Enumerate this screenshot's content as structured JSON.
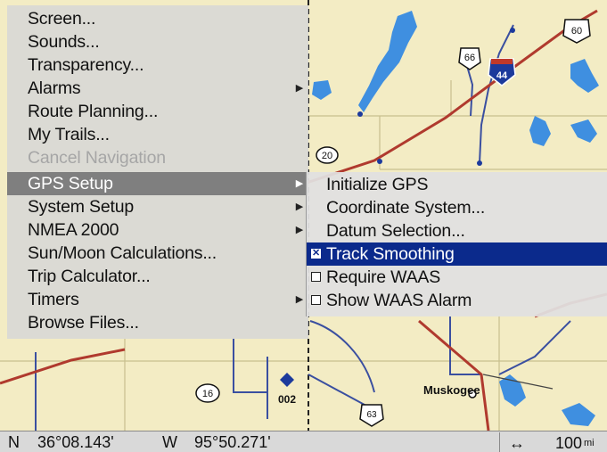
{
  "main_menu": {
    "items": [
      {
        "label": "Screen...",
        "submenu": false,
        "disabled": false,
        "active": false
      },
      {
        "label": "Sounds...",
        "submenu": false,
        "disabled": false,
        "active": false
      },
      {
        "label": "Transparency...",
        "submenu": false,
        "disabled": false,
        "active": false
      },
      {
        "label": "Alarms",
        "submenu": true,
        "disabled": false,
        "active": false
      },
      {
        "label": "Route Planning...",
        "submenu": false,
        "disabled": false,
        "active": false
      },
      {
        "label": "My Trails...",
        "submenu": false,
        "disabled": false,
        "active": false
      },
      {
        "label": "Cancel Navigation",
        "submenu": false,
        "disabled": true,
        "active": false
      },
      {
        "label": "GPS Setup",
        "submenu": true,
        "disabled": false,
        "active": true
      },
      {
        "label": "System Setup",
        "submenu": true,
        "disabled": false,
        "active": false
      },
      {
        "label": "NMEA 2000",
        "submenu": true,
        "disabled": false,
        "active": false
      },
      {
        "label": "Sun/Moon Calculations...",
        "submenu": false,
        "disabled": false,
        "active": false
      },
      {
        "label": "Trip Calculator...",
        "submenu": false,
        "disabled": false,
        "active": false
      },
      {
        "label": "Timers",
        "submenu": true,
        "disabled": false,
        "active": false
      },
      {
        "label": "Browse Files...",
        "submenu": false,
        "disabled": false,
        "active": false
      }
    ]
  },
  "gps_submenu": {
    "items": [
      {
        "label": "Initialize GPS",
        "type": "action"
      },
      {
        "label": "Coordinate System...",
        "type": "action"
      },
      {
        "label": "Datum Selection...",
        "type": "action"
      },
      {
        "label": "Track Smoothing",
        "type": "checkbox",
        "checked": true,
        "selected": true
      },
      {
        "label": "Require WAAS",
        "type": "checkbox",
        "checked": false,
        "selected": false
      },
      {
        "label": "Show WAAS Alarm",
        "type": "checkbox",
        "checked": false,
        "selected": false
      }
    ]
  },
  "map": {
    "shields": [
      {
        "label": "66",
        "kind": "us"
      },
      {
        "label": "60",
        "kind": "us"
      },
      {
        "label": "44",
        "kind": "interstate"
      },
      {
        "label": "20",
        "kind": "state"
      },
      {
        "label": "16",
        "kind": "state"
      },
      {
        "label": "63",
        "kind": "us"
      }
    ],
    "waypoint_label": "002",
    "city_label": "Muskogee",
    "colors": {
      "land": "#f3ecc4",
      "water": "#3f8fe0",
      "road": "#b03a2e",
      "minor_road": "#3a4fa0",
      "grid": "#c8bf8e"
    }
  },
  "status_bar": {
    "lat_hemisphere": "N",
    "latitude": "36°08.143'",
    "lon_hemisphere": "W",
    "longitude": "95°50.271'",
    "scale_icon": "↔",
    "scale_value": "100",
    "scale_unit": "mi"
  },
  "colors": {
    "selection": "#0b2a8c",
    "active_item": "#7f7f7f",
    "menu_bg": "#d6d6d6"
  }
}
